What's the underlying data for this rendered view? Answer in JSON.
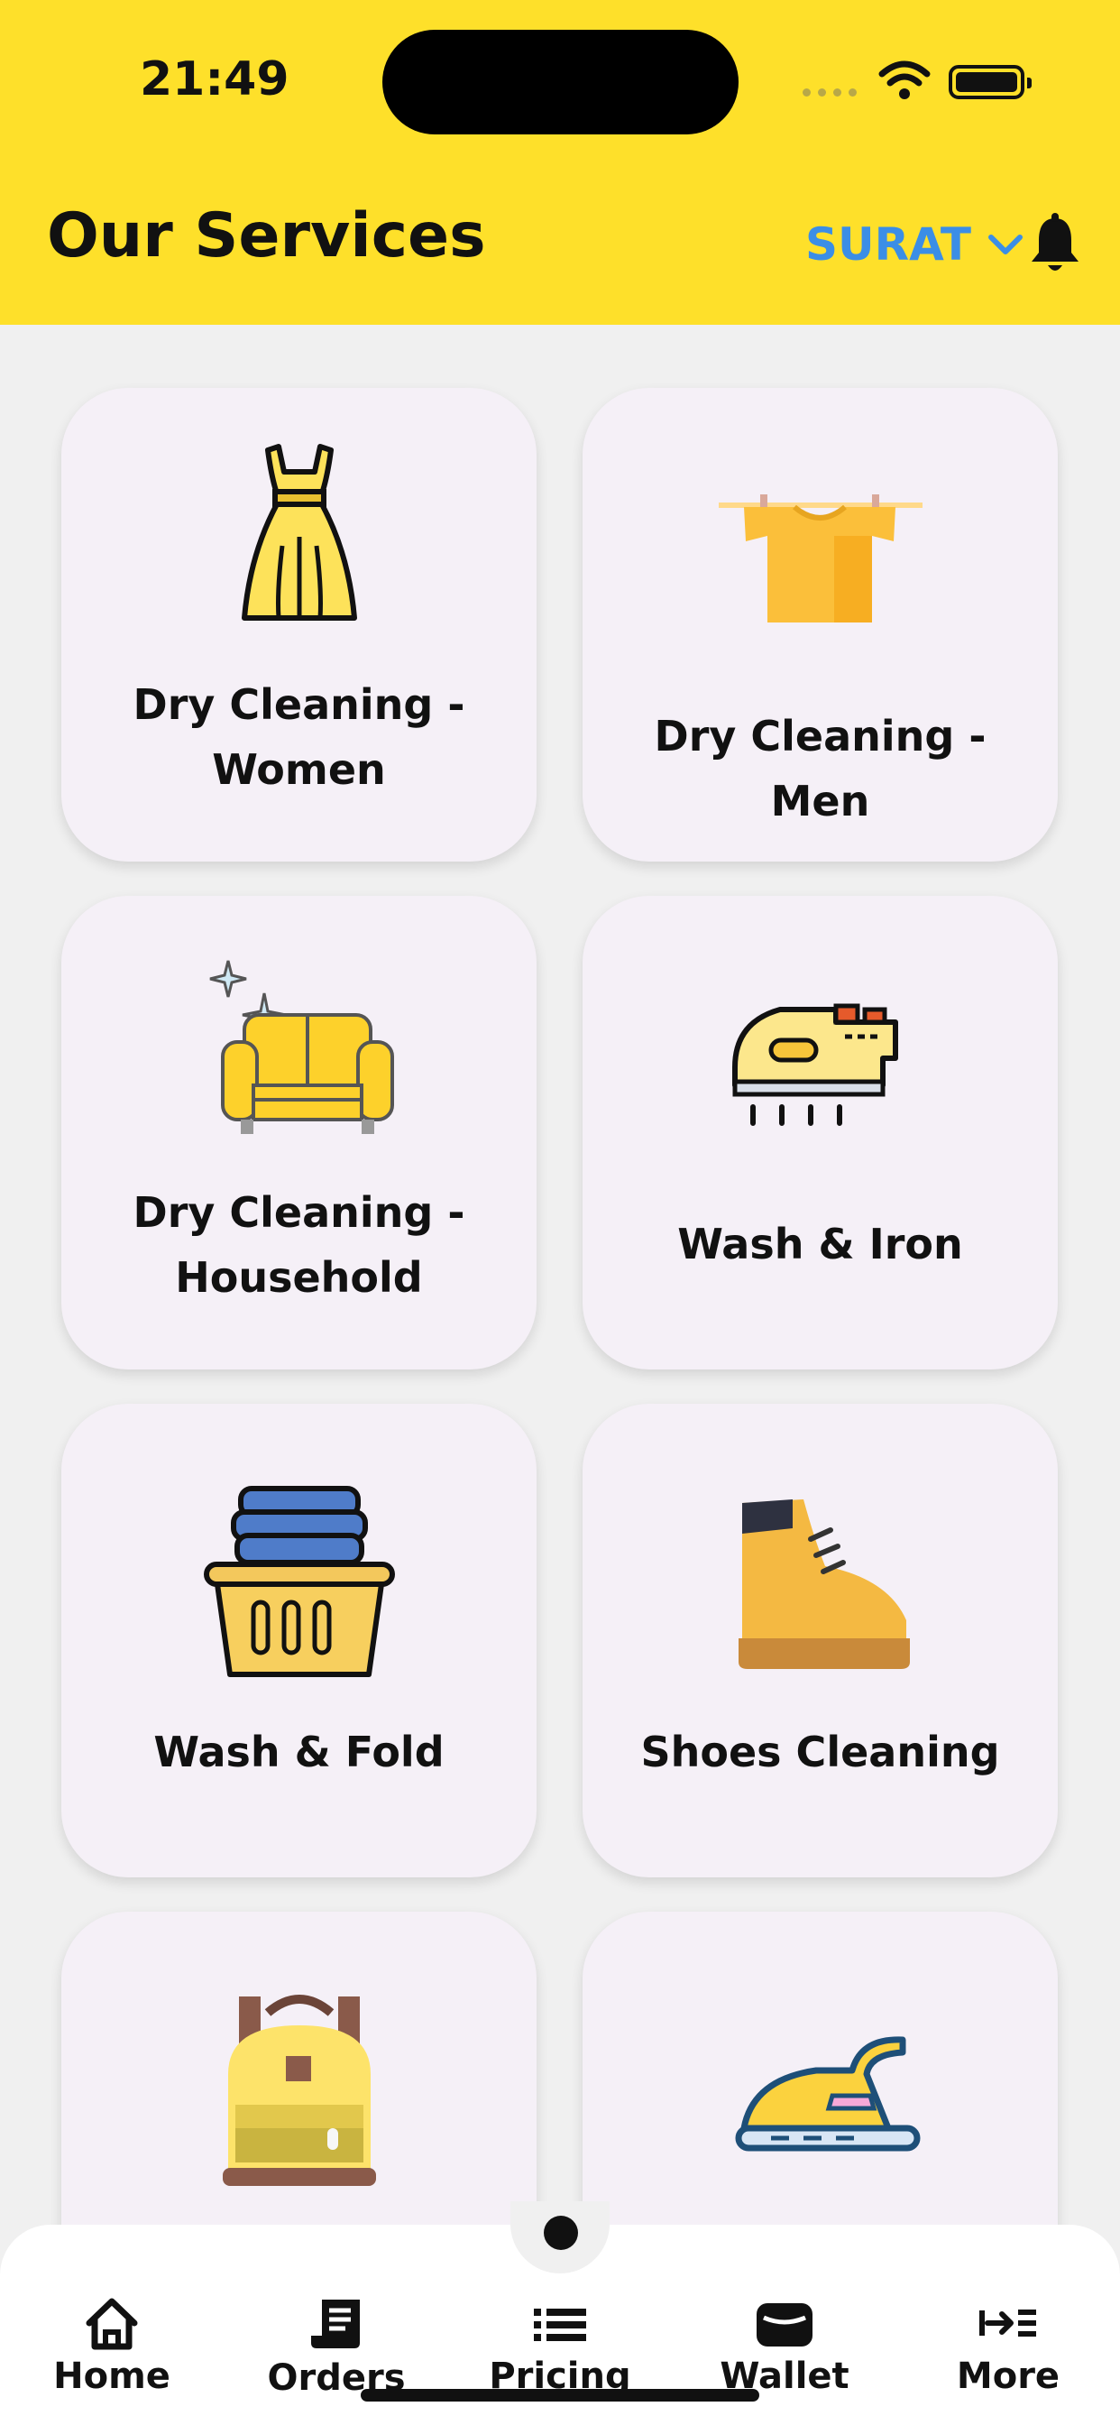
{
  "status_bar": {
    "time": "21:49"
  },
  "header": {
    "title": "Our Services",
    "city": "SURAT"
  },
  "services": [
    {
      "label": "Dry Cleaning - Women",
      "icon": "dress-icon"
    },
    {
      "label": "Dry Cleaning - Men",
      "icon": "shirt-on-line-icon"
    },
    {
      "label": "Dry Cleaning - Household",
      "icon": "sofa-icon"
    },
    {
      "label": "Wash & Iron",
      "icon": "steam-iron-icon"
    },
    {
      "label": "Wash & Fold",
      "icon": "laundry-basket-icon"
    },
    {
      "label": "Shoes Cleaning",
      "icon": "boot-icon"
    },
    {
      "label": "",
      "icon": "backpack-icon"
    },
    {
      "label": "",
      "icon": "iron-icon"
    }
  ],
  "tabs": [
    {
      "label": "Home",
      "icon": "home-icon"
    },
    {
      "label": "Orders",
      "icon": "receipt-icon"
    },
    {
      "label": "Pricing",
      "icon": "list-icon"
    },
    {
      "label": "Wallet",
      "icon": "wallet-icon"
    },
    {
      "label": "More",
      "icon": "more-arrow-icon"
    }
  ],
  "colors": {
    "header": "#fee02a",
    "city": "#3b8ee6",
    "card": "#f5f0f7"
  }
}
